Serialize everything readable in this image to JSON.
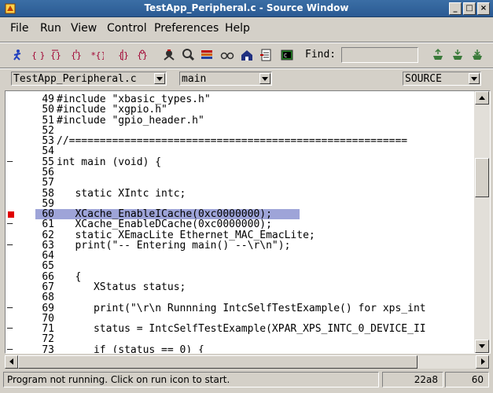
{
  "window": {
    "title": "TestApp_Peripheral.c - Source Window"
  },
  "menu": [
    "File",
    "Run",
    "View",
    "Control",
    "Preferences",
    "Help"
  ],
  "toolbar": {
    "buttons": [
      "run-icon",
      "step-icon",
      "next-icon",
      "finish-icon",
      "continue-icon",
      "stepi-icon",
      "nexti-icon",
      "breakpoints-icon",
      "locals-icon",
      "registers-icon",
      "memory-icon",
      "stack-icon",
      "watch-icon",
      "console-icon",
      "up-frame-icon",
      "down-frame-icon",
      "bottom-frame-icon"
    ],
    "find_label": "Find:",
    "find_value": ""
  },
  "combos": {
    "file": "TestApp_Peripheral.c",
    "function": "main",
    "mode": "SOURCE"
  },
  "code": [
    {
      "num": "49",
      "text": "#include \"xbasic_types.h\"",
      "mark": ""
    },
    {
      "num": "50",
      "text": "#include \"xgpio.h\"",
      "mark": ""
    },
    {
      "num": "51",
      "text": "#include \"gpio_header.h\"",
      "mark": ""
    },
    {
      "num": "52",
      "text": "",
      "mark": ""
    },
    {
      "num": "53",
      "text": "//=======================================================",
      "mark": ""
    },
    {
      "num": "54",
      "text": "",
      "mark": ""
    },
    {
      "num": "55",
      "text": "int main (void) {",
      "mark": "dash"
    },
    {
      "num": "56",
      "text": "",
      "mark": ""
    },
    {
      "num": "57",
      "text": "",
      "mark": ""
    },
    {
      "num": "58",
      "text": "   static XIntc intc;",
      "mark": ""
    },
    {
      "num": "59",
      "text": "",
      "mark": ""
    },
    {
      "num": "60",
      "text": "   XCache_EnableICache(0xc0000000);",
      "mark": "bp"
    },
    {
      "num": "61",
      "text": "   XCache_EnableDCache(0xc0000000);",
      "mark": "dash"
    },
    {
      "num": "62",
      "text": "   static XEmacLite Ethernet_MAC_EmacLite;",
      "mark": ""
    },
    {
      "num": "63",
      "text": "   print(\"-- Entering main() --\\r\\n\");",
      "mark": "dash"
    },
    {
      "num": "64",
      "text": "",
      "mark": ""
    },
    {
      "num": "65",
      "text": "",
      "mark": ""
    },
    {
      "num": "66",
      "text": "   {",
      "mark": ""
    },
    {
      "num": "67",
      "text": "      XStatus status;",
      "mark": ""
    },
    {
      "num": "68",
      "text": "",
      "mark": ""
    },
    {
      "num": "69",
      "text": "      print(\"\\r\\n Runnning IntcSelfTestExample() for xps_int",
      "mark": "dash"
    },
    {
      "num": "70",
      "text": "",
      "mark": ""
    },
    {
      "num": "71",
      "text": "      status = IntcSelfTestExample(XPAR_XPS_INTC_0_DEVICE_II",
      "mark": "dash"
    },
    {
      "num": "72",
      "text": "",
      "mark": ""
    },
    {
      "num": "73",
      "text": "      if (status == 0) {",
      "mark": "dash"
    }
  ],
  "highlight_line": "60",
  "status": {
    "message": "Program not running. Click on run icon to start.",
    "address": "22a8",
    "line": "60"
  },
  "colors": {
    "highlight": "#9ea4d8",
    "breakpoint": "#e00000",
    "titlebar": "#3b6ea5"
  }
}
